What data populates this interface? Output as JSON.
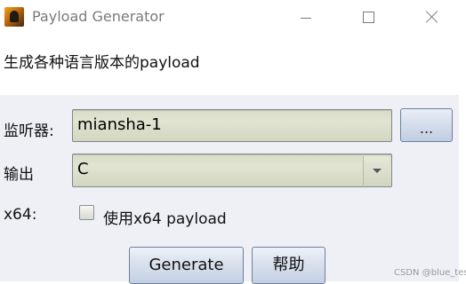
{
  "window": {
    "title": "Payload Generator",
    "controls": {
      "minimize": "minimize",
      "maximize": "maximize",
      "close": "close"
    }
  },
  "description": "生成各种语言版本的payload",
  "form": {
    "listener": {
      "label": "监听器:",
      "value": "miansha-1",
      "browse_label": "..."
    },
    "output": {
      "label": "输出",
      "selected": "C"
    },
    "x64": {
      "label": "x64:",
      "checkbox_label": "使用x64 payload",
      "checked": false
    }
  },
  "buttons": {
    "generate": "Generate",
    "help": "帮助"
  },
  "watermark": "CSDN @blue_test",
  "colors": {
    "form_background": "#eef0f6",
    "field_background": "#dcdfcb",
    "button_blue": "#c4d0e3"
  }
}
